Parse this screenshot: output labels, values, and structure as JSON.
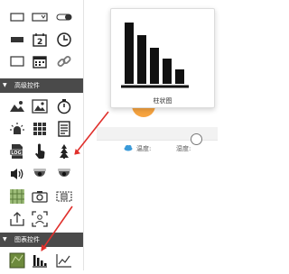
{
  "sections": [
    {
      "title": "高级控件"
    },
    {
      "title": "图表控件"
    }
  ],
  "popup": {
    "caption": "柱状图"
  },
  "weather": [
    {
      "label": "温度:"
    },
    {
      "label": "湿度:"
    }
  ],
  "colors": {
    "section_bg": "#4a4a4a",
    "accent_red": "#e0302c",
    "orange": "#f7a440"
  }
}
